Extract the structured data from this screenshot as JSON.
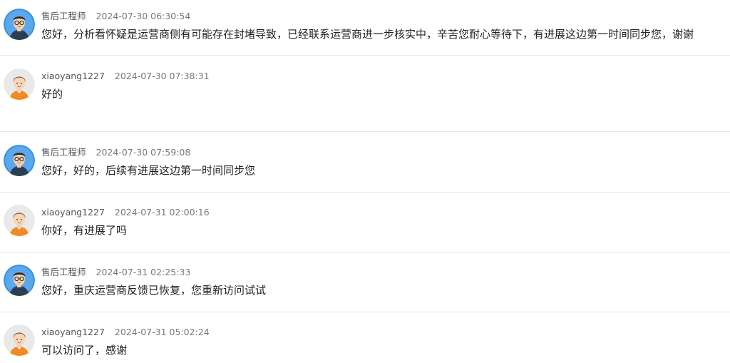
{
  "colors": {
    "engineer_avatar_bg": "#3a8fd9",
    "user_avatar_shirt": "#f08a24",
    "divider": "#e6e6e6"
  },
  "messages": [
    {
      "author": "售后工程师",
      "time": "2024-07-30 06:30:54",
      "text": "您好，分析看怀疑是运营商侧有可能存在封堵导致，已经联系运营商进一步核实中，辛苦您耐心等待下，有进展这边第一时间同步您，谢谢",
      "avatar": "engineer-avatar"
    },
    {
      "author": "xiaoyang1227",
      "time": "2024-07-30 07:38:31",
      "text": "好的",
      "avatar": "user-avatar"
    },
    {
      "author": "售后工程师",
      "time": "2024-07-30 07:59:08",
      "text": "您好，好的，后续有进展这边第一时间同步您",
      "avatar": "engineer-avatar"
    },
    {
      "author": "xiaoyang1227",
      "time": "2024-07-31 02:00:16",
      "text": "你好，有进展了吗",
      "avatar": "user-avatar"
    },
    {
      "author": "售后工程师",
      "time": "2024-07-31 02:25:33",
      "text": "您好，重庆运营商反馈已恢复，您重新访问试试",
      "avatar": "engineer-avatar"
    },
    {
      "author": "xiaoyang1227",
      "time": "2024-07-31 05:02:24",
      "text": "可以访问了，感谢",
      "avatar": "user-avatar"
    }
  ]
}
